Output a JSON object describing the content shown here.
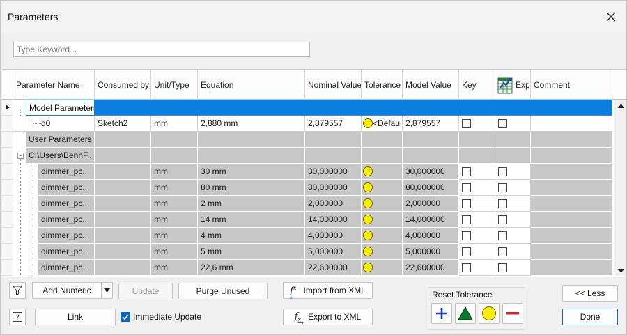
{
  "window": {
    "title": "Parameters",
    "close_icon": "close-icon"
  },
  "search": {
    "placeholder": "Type Keyword..."
  },
  "table": {
    "headers": {
      "parameter_name": "Parameter Name",
      "consumed_by": "Consumed by",
      "unit_type": "Unit/Type",
      "equation": "Equation",
      "nominal_value": "Nominal Value",
      "tolerance": "Tolerance",
      "model_value": "Model Value",
      "key": "Key",
      "export": "Exp",
      "comment": "Comment"
    },
    "groups": {
      "model": "Model Parameters",
      "user": "User Parameters",
      "file": "C:\\Users\\BennF..."
    },
    "d0": {
      "name": "d0",
      "consumed_by": "Sketch2",
      "unit": "mm",
      "equation": "2,880 mm",
      "nominal": "2,879557",
      "tolerance": "<Defau",
      "model": "2,879557"
    },
    "rows": [
      {
        "name": "dimmer_pc...",
        "unit": "mm",
        "equation": "30 mm",
        "nominal": "30,000000",
        "model": "30,000000"
      },
      {
        "name": "dimmer_pc...",
        "unit": "mm",
        "equation": "80 mm",
        "nominal": "80,000000",
        "model": "80,000000"
      },
      {
        "name": "dimmer_pc...",
        "unit": "mm",
        "equation": "2 mm",
        "nominal": "2,000000",
        "model": "2,000000"
      },
      {
        "name": "dimmer_pc...",
        "unit": "mm",
        "equation": "14 mm",
        "nominal": "14,000000",
        "model": "14,000000"
      },
      {
        "name": "dimmer_pc...",
        "unit": "mm",
        "equation": "4 mm",
        "nominal": "4,000000",
        "model": "4,000000"
      },
      {
        "name": "dimmer_pc...",
        "unit": "mm",
        "equation": "5 mm",
        "nominal": "5,000000",
        "model": "5,000000"
      },
      {
        "name": "dimmer_pc...",
        "unit": "mm",
        "equation": "22,6 mm",
        "nominal": "22,600000",
        "model": "22,600000"
      }
    ]
  },
  "footer": {
    "add_numeric": "Add Numeric",
    "update": "Update",
    "purge_unused": "Purge Unused",
    "import_xml": "Import from XML",
    "export_xml": "Export to XML",
    "link": "Link",
    "immediate_update": "Immediate Update",
    "reset_tolerance": "Reset Tolerance",
    "less": "<< Less",
    "done": "Done"
  },
  "colors": {
    "selection": "#0a7fe0",
    "tolerance_dot": "#ffee00",
    "group_gray": "#c7c7c7"
  }
}
